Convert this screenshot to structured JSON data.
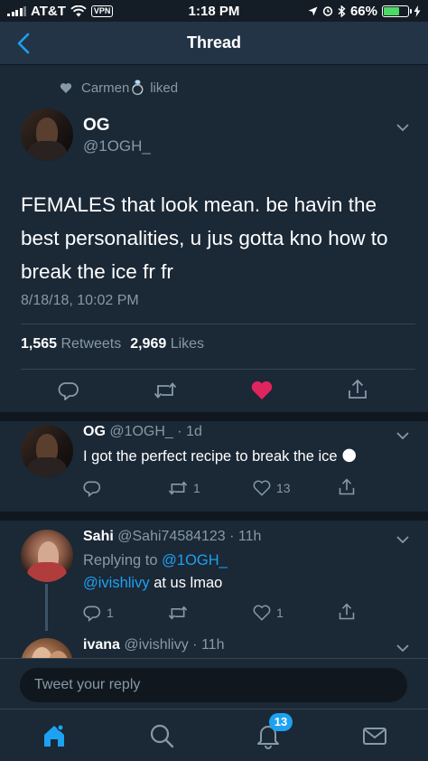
{
  "status_bar": {
    "carrier": "AT&T",
    "vpn": "VPN",
    "time": "1:18 PM",
    "battery": "66%",
    "battery_level": 0.66
  },
  "nav": {
    "title": "Thread"
  },
  "liked_by": {
    "name": "Carmen",
    "suffix": "liked"
  },
  "main_tweet": {
    "name": "OG",
    "handle": "@1OGH_",
    "text": "FEMALES that look mean. be havin the best personalities, u jus gotta kno how to break the ice fr fr",
    "timestamp": "8/18/18, 10:02 PM",
    "retweets_count": "1,565",
    "retweets_label": "Retweets",
    "likes_count": "2,969",
    "likes_label": "Likes"
  },
  "replies": [
    {
      "name": "OG",
      "handle": "@1OGH_ · 1d",
      "text": "I got the perfect recipe to break the ice 🌑",
      "replies": "",
      "retweets": "1",
      "likes": "13"
    },
    {
      "name": "Sahi",
      "handle": "@Sahi74584123 · 11h",
      "replying_label": "Replying to",
      "replying_to": "@1OGH_",
      "mention": "@ivishlivy",
      "text": "at us lmao",
      "replies": "1",
      "retweets": "",
      "likes": "1"
    },
    {
      "name": "ivana",
      "handle": "@ivishlivy · 11h"
    }
  ],
  "composer": {
    "placeholder": "Tweet your reply"
  },
  "tabbar": {
    "notifications_badge": "13"
  },
  "colors": {
    "background": "#141d26",
    "card": "#1b2836",
    "accent": "#1da1f2",
    "like": "#e0245e",
    "secondary": "#8899a6"
  }
}
